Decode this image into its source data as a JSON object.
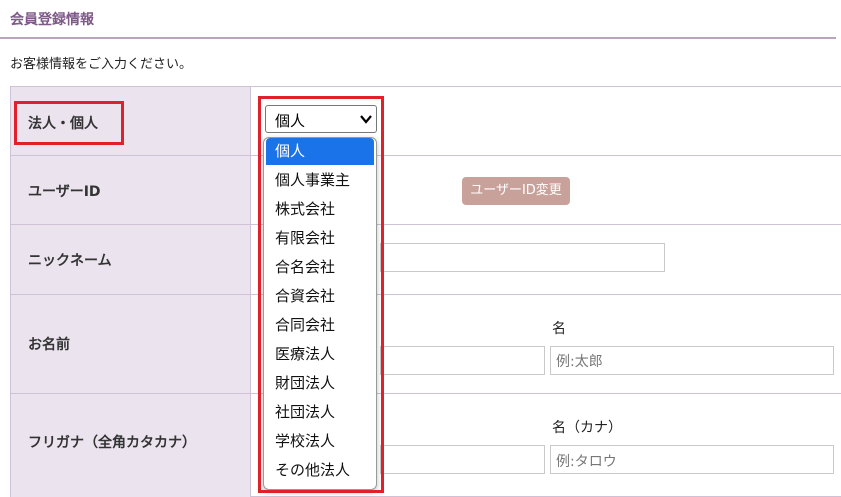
{
  "section_title": "会員登録情報",
  "intro_text": "お客様情報をご入力ください。",
  "rows": {
    "corp_label": "法人・個人",
    "userid_label": "ユーザーID",
    "nickname_label": "ニックネーム",
    "name_label": "お名前",
    "furigana_label": "フリガナ（全角カタカナ）"
  },
  "corp_select": {
    "value": "個人",
    "options": [
      "個人",
      "個人事業主",
      "株式会社",
      "有限会社",
      "合名会社",
      "合資会社",
      "合同会社",
      "医療法人",
      "財団法人",
      "社団法人",
      "学校法人",
      "その他法人"
    ]
  },
  "userid_change_button": "ユーザーID変更",
  "name_fields": {
    "given_label": "名",
    "given_placeholder": "例:太郎"
  },
  "furigana_fields": {
    "given_label": "名（カナ）",
    "given_placeholder": "例:タロウ"
  },
  "colors": {
    "accent": "#7d5a87",
    "highlight_red": "#e0202a",
    "button_bg": "#c9a19b",
    "label_bg": "#ebe4ef",
    "selected_option": "#1a73e8"
  }
}
